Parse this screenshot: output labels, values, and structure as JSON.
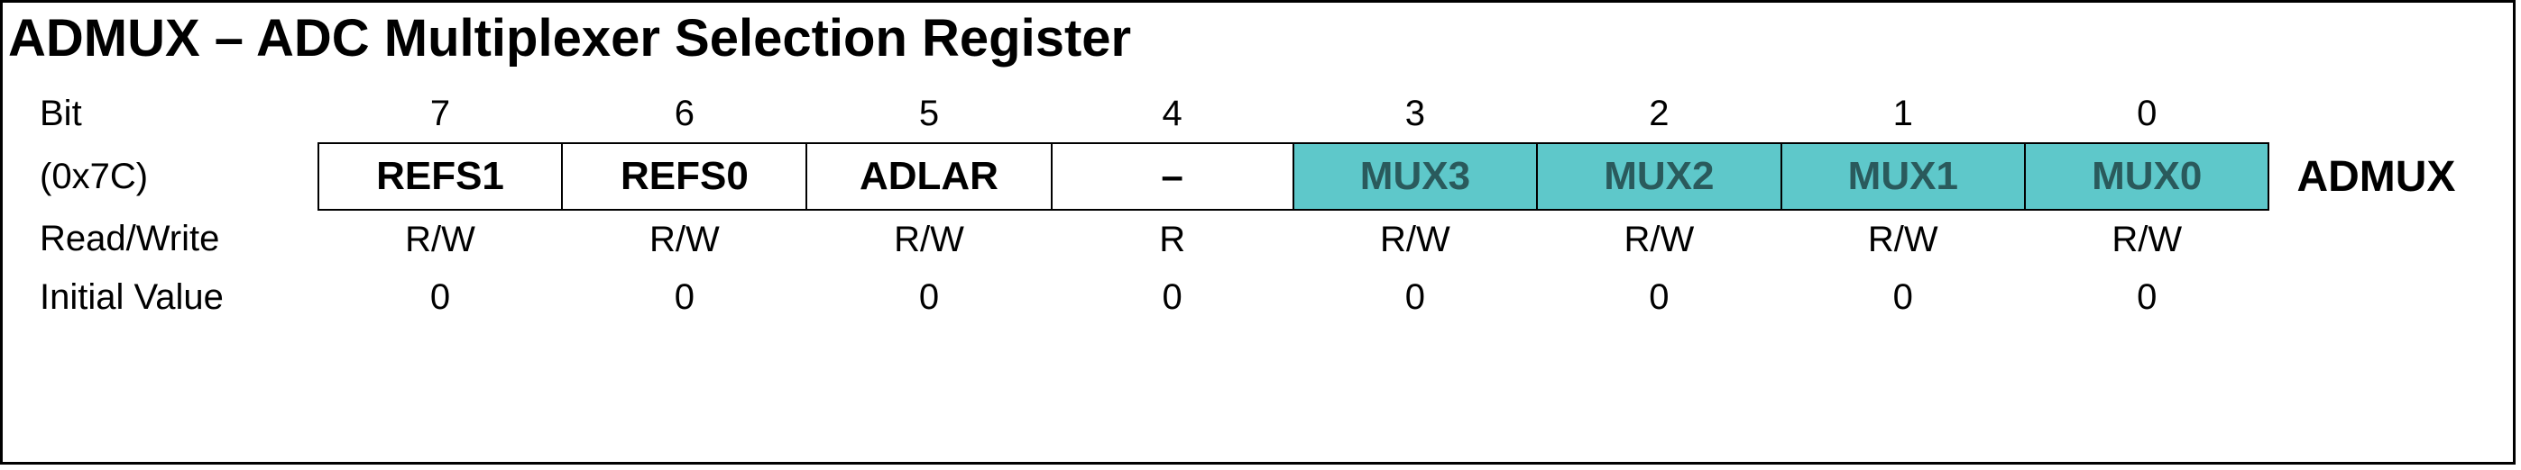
{
  "title": "ADMUX – ADC Multiplexer Selection Register",
  "labels": {
    "bit": "Bit",
    "address": "(0x7C)",
    "readwrite": "Read/Write",
    "initial": "Initial Value",
    "regname": "ADMUX"
  },
  "bits": {
    "numbers": [
      "7",
      "6",
      "5",
      "4",
      "3",
      "2",
      "1",
      "0"
    ],
    "names": [
      "REFS1",
      "REFS0",
      "ADLAR",
      "–",
      "MUX3",
      "MUX2",
      "MUX1",
      "MUX0"
    ],
    "highlight": [
      false,
      false,
      false,
      false,
      true,
      true,
      true,
      true
    ],
    "rw": [
      "R/W",
      "R/W",
      "R/W",
      "R",
      "R/W",
      "R/W",
      "R/W",
      "R/W"
    ],
    "initial": [
      "0",
      "0",
      "0",
      "0",
      "0",
      "0",
      "0",
      "0"
    ]
  }
}
